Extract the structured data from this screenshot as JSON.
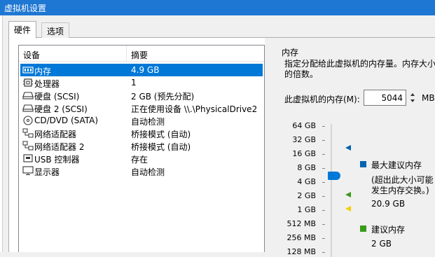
{
  "window": {
    "title": "虚拟机设置"
  },
  "tabs": [
    {
      "label": "硬件",
      "active": true
    },
    {
      "label": "选项",
      "active": false
    }
  ],
  "device_list": {
    "columns": {
      "device": "设备",
      "summary": "摘要"
    },
    "rows": [
      {
        "icon": "memory-icon",
        "name": "内存",
        "summary": "4.9 GB",
        "selected": true
      },
      {
        "icon": "cpu-icon",
        "name": "处理器",
        "summary": "1"
      },
      {
        "icon": "disk-icon",
        "name": "硬盘 (SCSI)",
        "summary": "2 GB (预先分配)"
      },
      {
        "icon": "disk-icon",
        "name": "硬盘 2 (SCSI)",
        "summary": "正在使用设备 \\\\.\\PhysicalDrive2"
      },
      {
        "icon": "cd-icon",
        "name": "CD/DVD (SATA)",
        "summary": "自动检测"
      },
      {
        "icon": "network-icon",
        "name": "网络适配器",
        "summary": "桥接模式 (自动)"
      },
      {
        "icon": "network-icon",
        "name": "网络适配器 2",
        "summary": "桥接模式 (自动)"
      },
      {
        "icon": "usb-icon",
        "name": "USB 控制器",
        "summary": "存在"
      },
      {
        "icon": "monitor-icon",
        "name": "显示器",
        "summary": "自动检测"
      }
    ]
  },
  "memory": {
    "title": "内存",
    "description_line1": "指定分配给此虚拟机的内存量。内存大小",
    "description_line2": "的倍数。",
    "field_label": "此虚拟机的内存(M):",
    "value": "5044",
    "unit": "MB",
    "scale": [
      "64 GB",
      "32 GB",
      "16 GB",
      "8 GB",
      "4 GB",
      "2 GB",
      "1 GB",
      "512 MB",
      "256 MB",
      "128 MB"
    ],
    "legend": {
      "max_recommended": {
        "label": "最大建议内存",
        "note_line1": "(超出此大小可能",
        "note_line2": "发生内存交换。)",
        "value": "20.9 GB",
        "color": "#0063b1"
      },
      "recommended": {
        "label": "建议内存",
        "value": "2 GB",
        "color": "#3a9b1a"
      }
    },
    "colors": {
      "accent": "#0078d7",
      "marker_blue": "#0063b1",
      "marker_green": "#3a9b1a",
      "marker_yellow": "#f2d000"
    }
  }
}
